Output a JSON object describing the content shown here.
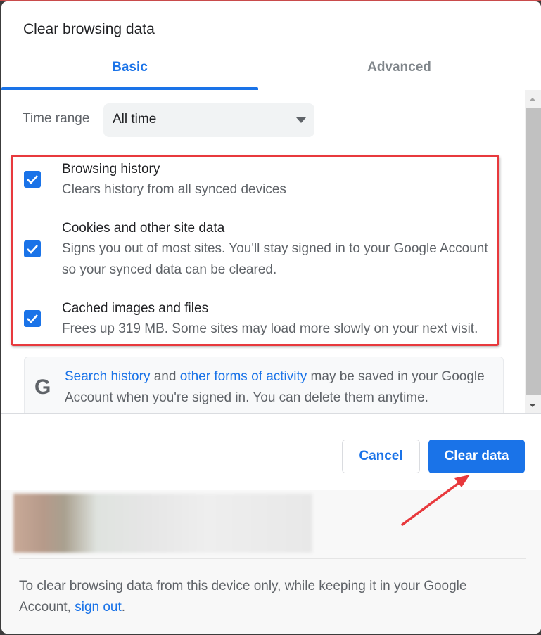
{
  "dialog": {
    "title": "Clear browsing data"
  },
  "tabs": [
    {
      "label": "Basic",
      "selected": true
    },
    {
      "label": "Advanced",
      "selected": false
    }
  ],
  "time_range": {
    "label": "Time range",
    "value": "All time"
  },
  "items": [
    {
      "title": "Browsing history",
      "desc": [
        "Clears history from all synced devices"
      ],
      "checked": true
    },
    {
      "title": "Cookies and other site data",
      "desc": [
        "Signs you out of most sites. You'll stay signed in to your Google Account",
        "so your synced data can be cleared."
      ],
      "checked": true
    },
    {
      "title": "Cached images and files",
      "desc": [
        "Frees up 319 MB. Some sites may load more slowly on your next visit."
      ],
      "checked": true
    }
  ],
  "google_notice": {
    "icon": "G",
    "link1": "Search history",
    "text1": " and ",
    "link2": "other forms of activity",
    "text2": " may be saved in your Google Account when you're signed in. You can delete them anytime."
  },
  "buttons": {
    "cancel": "Cancel",
    "clear": "Clear data"
  },
  "footer": {
    "text": "To clear browsing data from this device only, while keeping it in your Google Account, ",
    "link": "sign out",
    "end": "."
  },
  "colors": {
    "accent": "#1a73e8",
    "annotation": "#e8393d"
  }
}
